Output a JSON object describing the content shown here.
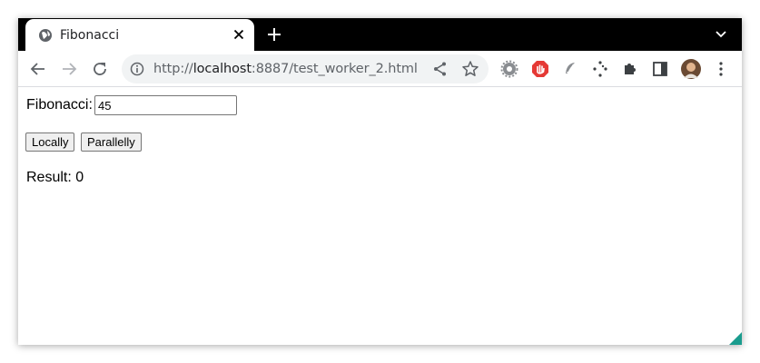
{
  "browser": {
    "tab": {
      "title": "Fibonacci"
    },
    "address": {
      "scheme": "http://",
      "host": "localhost",
      "rest": ":8887/test_worker_2.html"
    }
  },
  "page": {
    "fib_label": "Fibonacci:",
    "fib_value": "45",
    "buttons": {
      "locally": "Locally",
      "parallelly": "Parallelly"
    },
    "result_label": "Result:",
    "result_value": "0"
  },
  "icons": {
    "tab": "globe-icon",
    "toolbar": [
      "back-icon",
      "forward-icon",
      "reload-icon",
      "info-icon",
      "share-icon",
      "star-icon",
      "gear-extension-icon",
      "stop-extension-icon",
      "feather-extension-icon",
      "dots-extension-icon",
      "puzzle-extension-icon",
      "sidepanel-icon",
      "avatar",
      "menu-icon"
    ]
  },
  "colors": {
    "tabstrip": "#000000",
    "omnibox": "#f1f3f4",
    "red_ext": "#e53935",
    "corner": "#1a9c8e"
  }
}
